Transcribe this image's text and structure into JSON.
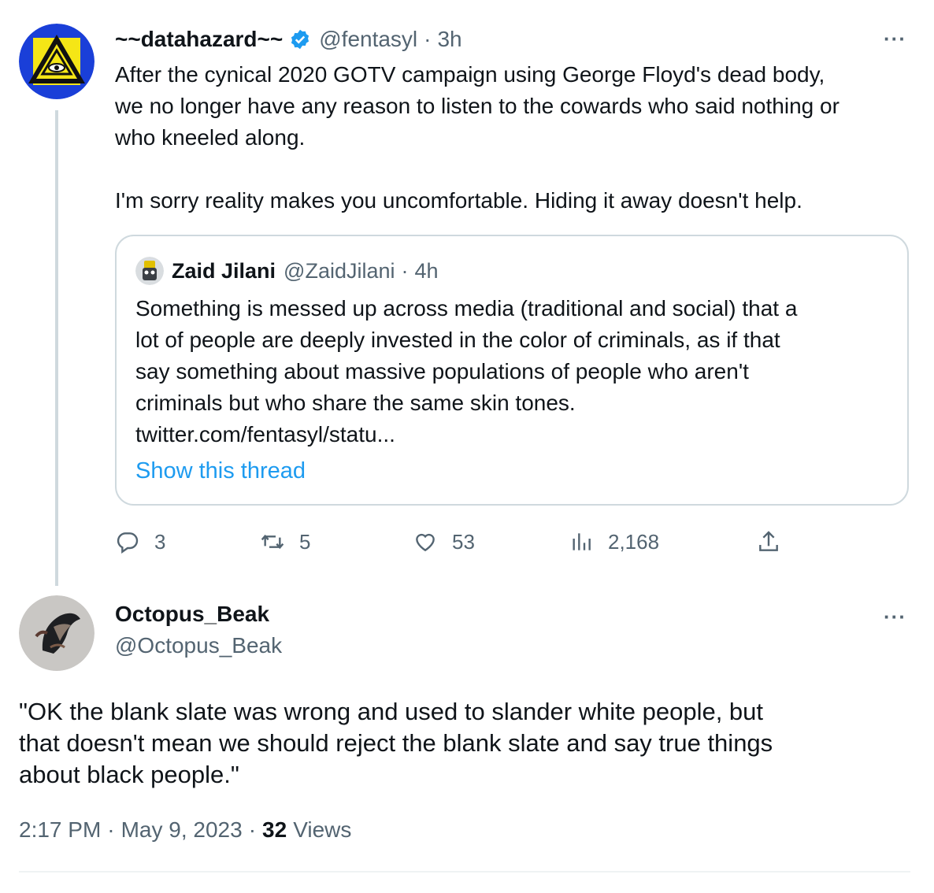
{
  "tweet": {
    "author_name": "~~datahazard~~",
    "handle": "@fentasyl",
    "separator": "·",
    "time": "3h",
    "more_label": "···",
    "text": "After the cynical 2020 GOTV campaign using George Floyd's dead body,\nwe no longer have any reason to listen to the cowards who said nothing or\nwho kneeled along.\n\nI'm sorry reality makes you uncomfortable. Hiding it away doesn't help.",
    "verified_color": "#1d9bf0",
    "quote": {
      "author_name": "Zaid Jilani",
      "handle": "@ZaidJilani",
      "separator": "·",
      "time": "4h",
      "text": "Something is messed up across media (traditional and social) that a\nlot of people are deeply invested in the color of criminals, as if that\nsay something about massive populations of people who aren't\ncriminals but who share the same skin tones.\ntwitter.com/fentasyl/statu...",
      "show_thread": "Show this thread"
    },
    "actions": {
      "replies": "3",
      "retweets": "5",
      "likes": "53",
      "views": "2,168"
    }
  },
  "reply": {
    "author_name": "Octopus_Beak",
    "handle": "@Octopus_Beak",
    "more_label": "···",
    "text": "\"OK the blank slate was wrong and used to slander white people, but\nthat doesn't mean we should reject the blank slate and say true things\nabout black people.\"",
    "time": "2:17 PM",
    "date": "May 9, 2023",
    "sep1": "·",
    "sep2": "·",
    "views_count": "32",
    "views_label": "Views"
  },
  "colors": {
    "accent": "#1d9bf0",
    "secondary_text": "#536471",
    "border": "#cfd9de",
    "hazard_yellow": "#f5e616",
    "hazard_blue": "#1a3fd8"
  }
}
